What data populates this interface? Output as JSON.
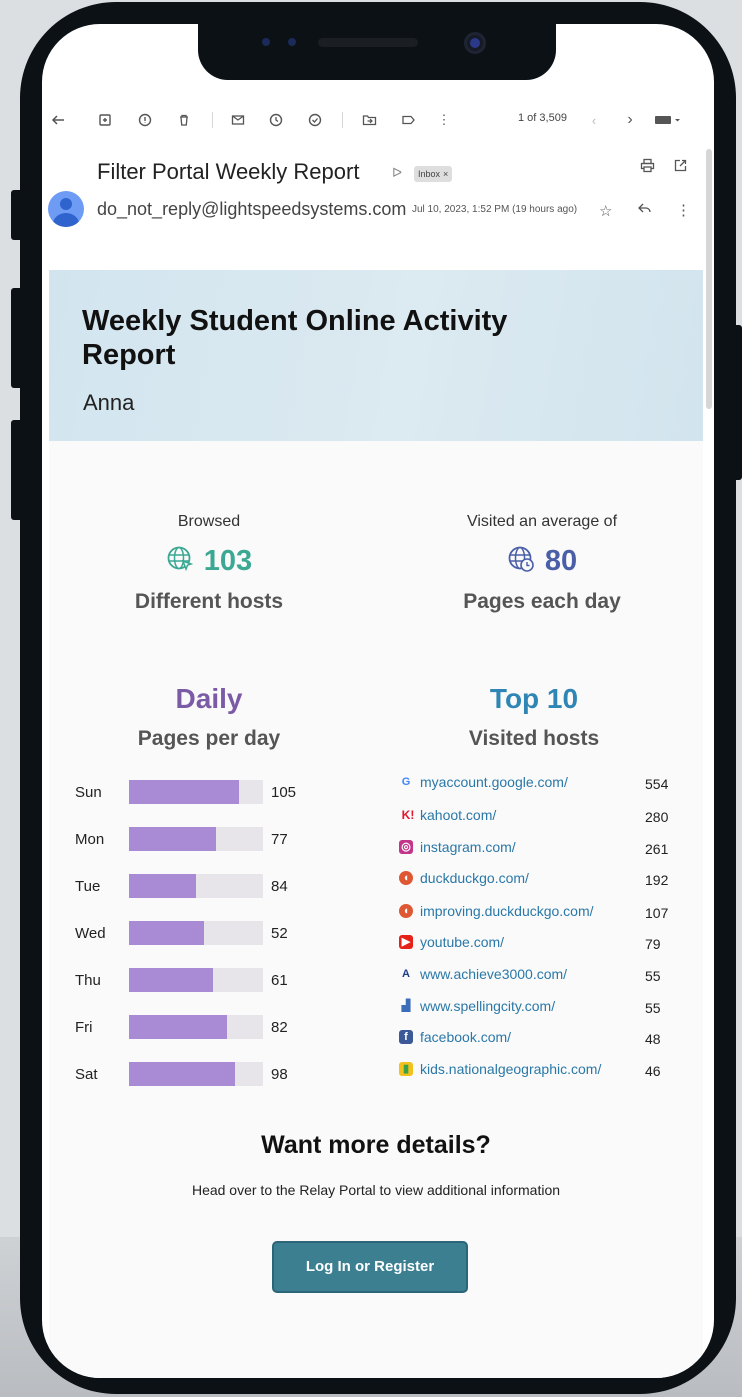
{
  "toolbar": {
    "pager": "1 of 3,509",
    "icons": [
      "back-arrow-icon",
      "archive-icon",
      "report-spam-icon",
      "delete-icon",
      "mark-unread-icon",
      "snooze-icon",
      "add-task-icon",
      "move-to-icon",
      "label-icon",
      "more-vert-icon",
      "prev-icon",
      "next-icon",
      "keyboard-icon"
    ]
  },
  "email": {
    "subject": "Filter Portal Weekly Report",
    "label_chip": "Inbox",
    "label_chip_close": "×",
    "sender": "do_not_reply@lightspeedsystems.com",
    "date": "Jul 10, 2023, 1:52 PM (19 hours ago)"
  },
  "report": {
    "title": "Weekly Student Online Activity Report",
    "student": "Anna",
    "stats": {
      "hosts": {
        "pre": "Browsed",
        "value": "103",
        "post": "Different hosts",
        "color": "#3aa892"
      },
      "pages": {
        "pre": "Visited an average of",
        "value": "80",
        "post": "Pages each day",
        "color": "#4a5fa8"
      }
    },
    "daily": {
      "title": "Daily",
      "subtitle": "Pages per day",
      "title_color": "#7b5aa6",
      "days": [
        {
          "label": "Sun",
          "value": "105",
          "fill": 0.82
        },
        {
          "label": "Mon",
          "value": "77",
          "fill": 0.65
        },
        {
          "label": "Tue",
          "value": "84",
          "fill": 0.5
        },
        {
          "label": "Wed",
          "value": "52",
          "fill": 0.56
        },
        {
          "label": "Thu",
          "value": "61",
          "fill": 0.63
        },
        {
          "label": "Fri",
          "value": "82",
          "fill": 0.73
        },
        {
          "label": "Sat",
          "value": "98",
          "fill": 0.79
        }
      ]
    },
    "top10": {
      "title": "Top 10",
      "subtitle": "Visited hosts",
      "title_color": "#2f86b5",
      "hosts": [
        {
          "name": "myaccount.google.com/",
          "value": "554",
          "icon": "google-icon",
          "glyph": "G",
          "color": "#4285f4",
          "bg": "transparent"
        },
        {
          "name": "kahoot.com/",
          "value": "280",
          "icon": "kahoot-icon",
          "glyph": "K!",
          "color": "#e0182d",
          "bg": "transparent"
        },
        {
          "name": "instagram.com/",
          "value": "261",
          "icon": "instagram-icon",
          "glyph": "◎",
          "color": "#ffffff",
          "bg": "#c1358b"
        },
        {
          "name": "duckduckgo.com/",
          "value": "192",
          "icon": "duckduckgo-icon",
          "glyph": "◖",
          "color": "#ffffff",
          "bg": "#de5833"
        },
        {
          "name": "improving.duckduckgo.com/",
          "value": "107",
          "icon": "duckduckgo-icon",
          "glyph": "◖",
          "color": "#ffffff",
          "bg": "#de5833"
        },
        {
          "name": "youtube.com/",
          "value": "79",
          "icon": "youtube-icon",
          "glyph": "▶",
          "color": "#ffffff",
          "bg": "#e62117"
        },
        {
          "name": "www.achieve3000.com/",
          "value": "55",
          "icon": "achieve3000-icon",
          "glyph": "A",
          "color": "#1d3f8a",
          "bg": "transparent"
        },
        {
          "name": "www.spellingcity.com/",
          "value": "55",
          "icon": "spellingcity-icon",
          "glyph": "▟",
          "color": "#3b6db8",
          "bg": "transparent"
        },
        {
          "name": "facebook.com/",
          "value": "48",
          "icon": "facebook-icon",
          "glyph": "f",
          "color": "#ffffff",
          "bg": "#3b5998"
        },
        {
          "name": "kids.nationalgeographic.com/",
          "value": "46",
          "icon": "natgeo-icon",
          "glyph": "▮",
          "color": "#3aa04a",
          "bg": "#f3c11b"
        }
      ]
    },
    "cta": {
      "title": "Want more details?",
      "description": "Head over to the Relay Portal to view additional information",
      "button": "Log In or Register"
    }
  }
}
